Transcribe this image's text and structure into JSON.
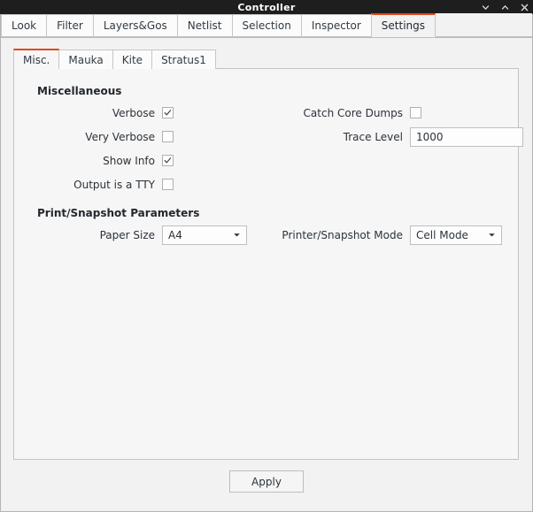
{
  "window": {
    "title": "Controller",
    "controls": [
      {
        "name": "minimize",
        "glyph": "chevron-down"
      },
      {
        "name": "maximize",
        "glyph": "chevron-up"
      },
      {
        "name": "close",
        "glyph": "x"
      }
    ]
  },
  "main_tabs": [
    {
      "label": "Look",
      "active": false
    },
    {
      "label": "Filter",
      "active": false
    },
    {
      "label": "Layers&Gos",
      "active": false
    },
    {
      "label": "Netlist",
      "active": false
    },
    {
      "label": "Selection",
      "active": false
    },
    {
      "label": "Inspector",
      "active": false
    },
    {
      "label": "Settings",
      "active": true
    }
  ],
  "inner_tabs": [
    {
      "label": "Misc.",
      "active": true
    },
    {
      "label": "Mauka",
      "active": false
    },
    {
      "label": "Kite",
      "active": false
    },
    {
      "label": "Stratus1",
      "active": false
    }
  ],
  "sections": {
    "miscellaneous": {
      "title": "Miscellaneous",
      "verbose": {
        "label": "Verbose",
        "checked": true
      },
      "very_verbose": {
        "label": "Very Verbose",
        "checked": false
      },
      "show_info": {
        "label": "Show Info",
        "checked": true
      },
      "output_is_a_tty": {
        "label": "Output is a TTY",
        "checked": false
      },
      "catch_core_dumps": {
        "label": "Catch Core Dumps",
        "checked": false
      },
      "trace_level": {
        "label": "Trace Level",
        "value": "1000",
        "placeholder": ""
      }
    },
    "print_snapshot": {
      "title": "Print/Snapshot Parameters",
      "paper_size": {
        "label": "Paper Size",
        "value": "A4"
      },
      "printer_snapshot_mode": {
        "label": "Printer/Snapshot Mode",
        "value": "Cell Mode"
      }
    }
  },
  "footer": {
    "apply_label": "Apply"
  },
  "colors": {
    "titlebar_bg": "#1e1e1e",
    "accent": "#e2491d",
    "window_bg": "#f2f2f2",
    "panel_bg": "#f6f6f6",
    "text": "#2b323a",
    "border": "#c2c2c2"
  }
}
